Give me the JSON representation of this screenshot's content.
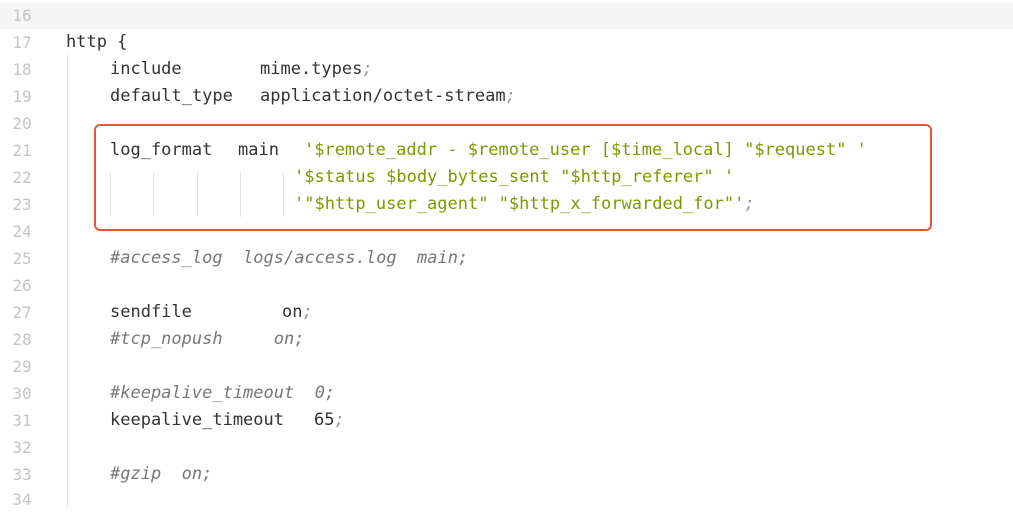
{
  "editor": {
    "lines": [
      {
        "num": "16",
        "text": ""
      },
      {
        "num": "17",
        "text": "http {"
      },
      {
        "num": "18",
        "directive": "include",
        "value": "mime.types",
        "semi": ";"
      },
      {
        "num": "19",
        "directive": "default_type",
        "value": "application/octet-stream",
        "semi": ";"
      },
      {
        "num": "20",
        "text": ""
      },
      {
        "num": "21",
        "directive": "log_format",
        "name": "main",
        "str": "'$remote_addr - $remote_user [$time_local] \"$request\" '"
      },
      {
        "num": "22",
        "str": "'$status $body_bytes_sent \"$http_referer\" '"
      },
      {
        "num": "23",
        "str": "'\"$http_user_agent\" \"$http_x_forwarded_for\"'",
        "semi": ";"
      },
      {
        "num": "24",
        "text": ""
      },
      {
        "num": "25",
        "comment": "#access_log  logs/access.log  main;"
      },
      {
        "num": "26",
        "text": ""
      },
      {
        "num": "27",
        "directive": "sendfile",
        "value": "on",
        "semi": ";"
      },
      {
        "num": "28",
        "comment": "#tcp_nopush     on;"
      },
      {
        "num": "29",
        "text": ""
      },
      {
        "num": "30",
        "comment": "#keepalive_timeout  0;"
      },
      {
        "num": "31",
        "directive": "keepalive_timeout",
        "value": "65",
        "semi": ";"
      },
      {
        "num": "32",
        "text": ""
      },
      {
        "num": "33",
        "comment": "#gzip  on;"
      },
      {
        "num": "34",
        "text": ""
      }
    ]
  },
  "colors": {
    "highlight_border": "#e8553a",
    "string": "#7a9a00",
    "comment": "#777777",
    "line_number": "#c4c4c4",
    "text": "#333333"
  }
}
